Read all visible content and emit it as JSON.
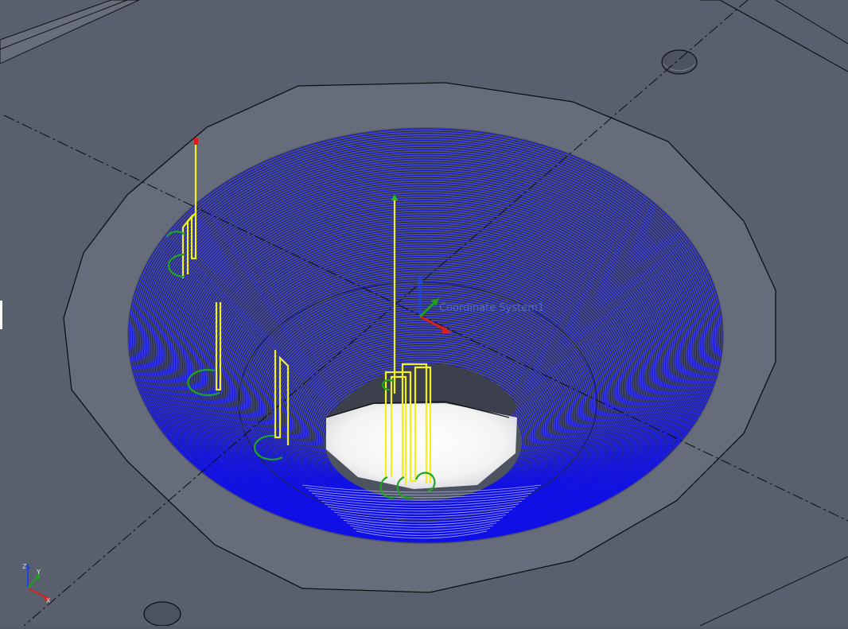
{
  "viewport": {
    "coordinate_system_label": "Coordinate System1"
  },
  "colors": {
    "background": "#565b69",
    "plate_face": "#5d6270",
    "plate_ring": "#656a78",
    "bowl_wall": "#4c5160",
    "toolpath": "#1010e6",
    "link_moves": "#f2f21e",
    "lead_arcs": "#1ea11e",
    "edges": "#101218",
    "hole_highlight": "#ffffff"
  },
  "icons": [
    "view-triad-icon",
    "coordinate-system-icon"
  ]
}
